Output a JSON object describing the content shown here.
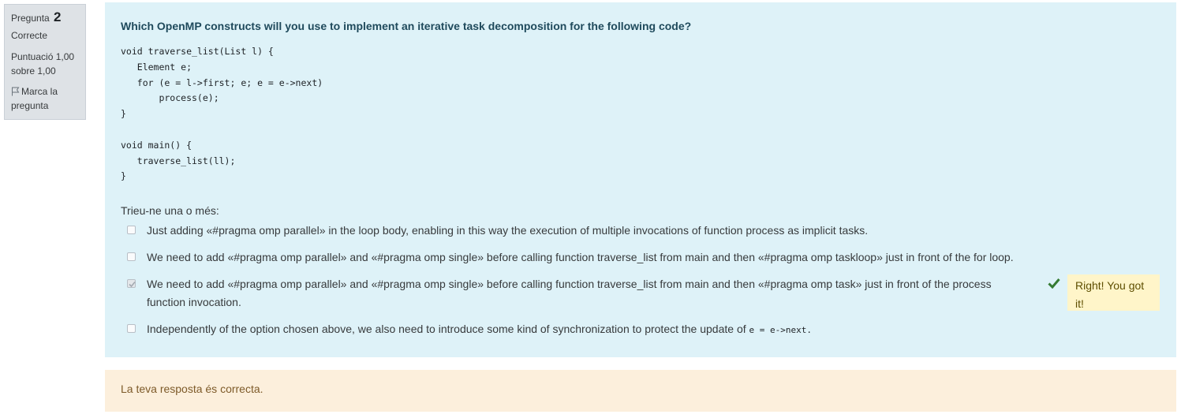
{
  "info": {
    "question_label": "Pregunta",
    "question_number": "2",
    "state": "Correcte",
    "grade": "Puntuació 1,00 sobre 1,00",
    "flag_label": "Marca la pregunta"
  },
  "question": {
    "text": "Which OpenMP constructs will you use to implement an iterative task decomposition for the following code?",
    "code": "void traverse_list(List l) {\n   Element e;\n   for (e = l->first; e; e = e->next)\n       process(e);\n}\n\nvoid main() {\n   traverse_list(ll);\n}"
  },
  "answer": {
    "prompt": "Trieu-ne una o més:",
    "options": [
      {
        "label": "Just adding «#pragma omp parallel» in the loop body, enabling in this way the execution of multiple invocations of function process as implicit tasks.",
        "checked": false
      },
      {
        "label": "We need to add «#pragma omp parallel» and «#pragma omp single» before calling function traverse_list from main and then «#pragma omp taskloop» just in front of the for loop.",
        "checked": false
      },
      {
        "label": "We need to add «#pragma omp parallel» and «#pragma omp single» before calling function traverse_list from main and then «#pragma omp task» just in front of the process function invocation.",
        "checked": true
      },
      {
        "label_prefix": "Independently of the option chosen above, we also need to introduce some kind of synchronization to protect the update of",
        "label_code": "e = e->next.",
        "checked": false
      }
    ],
    "feedback": "Right! You got it!"
  },
  "outcome": "La teva resposta és correcta.",
  "colors": {
    "formulation_bg": "#def2f8",
    "outcome_bg": "#fcefdc",
    "feedback_bg": "#fff5c9",
    "tick": "#357a32"
  },
  "icons": {
    "flag": "flag-icon",
    "tick": "check-icon"
  }
}
